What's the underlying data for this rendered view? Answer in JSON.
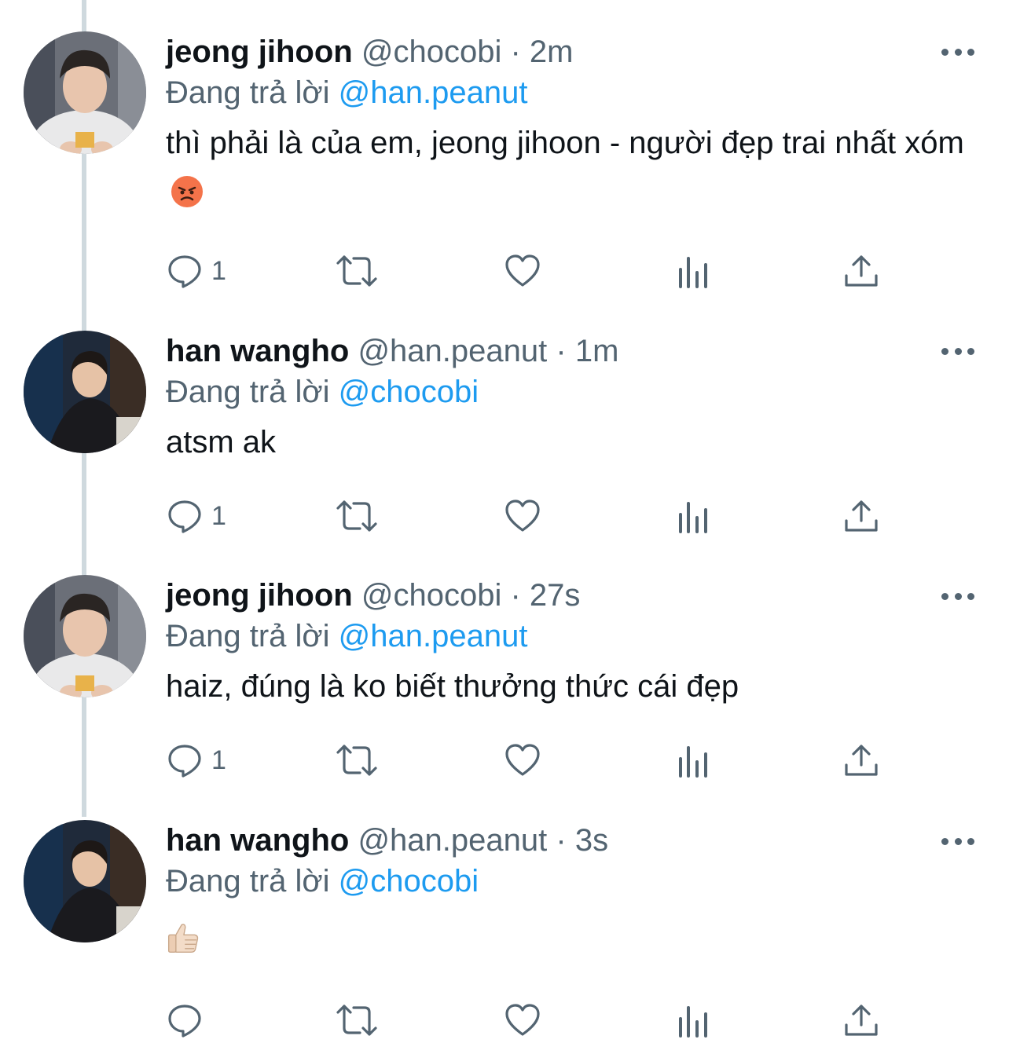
{
  "tweets": [
    {
      "name": "jeong jihoon",
      "handle": "@chocobi",
      "separator": "·",
      "time": "2m",
      "reply_prefix": "Đang trả lời",
      "reply_to": "@han.peanut",
      "text": "thì phải là của em, jeong jihoon - người đẹp trai nhất xóm",
      "emoji": "angry-face-icon",
      "reply_count": "1"
    },
    {
      "name": "han wangho",
      "handle": "@han.peanut",
      "separator": "·",
      "time": "1m",
      "reply_prefix": "Đang trả lời",
      "reply_to": "@chocobi",
      "text": "atsm ak",
      "reply_count": "1"
    },
    {
      "name": "jeong jihoon",
      "handle": "@chocobi",
      "separator": "·",
      "time": "27s",
      "reply_prefix": "Đang trả lời",
      "reply_to": "@han.peanut",
      "text": "haiz, đúng là ko biết thưởng thức cái đẹp",
      "reply_count": "1"
    },
    {
      "name": "han wangho",
      "handle": "@han.peanut",
      "separator": "·",
      "time": "3s",
      "reply_prefix": "Đang trả lời",
      "reply_to": "@chocobi",
      "text": "",
      "emoji": "thumbs-up-icon",
      "reply_count": ""
    }
  ],
  "icons": {
    "reply": "reply-icon",
    "retweet": "retweet-icon",
    "like": "heart-icon",
    "views": "views-icon",
    "share": "share-icon",
    "more": "more-icon"
  },
  "colors": {
    "text": "#0f1419",
    "secondary": "#536471",
    "accent": "#1d9bf0",
    "thread_line": "#cfd9de"
  }
}
